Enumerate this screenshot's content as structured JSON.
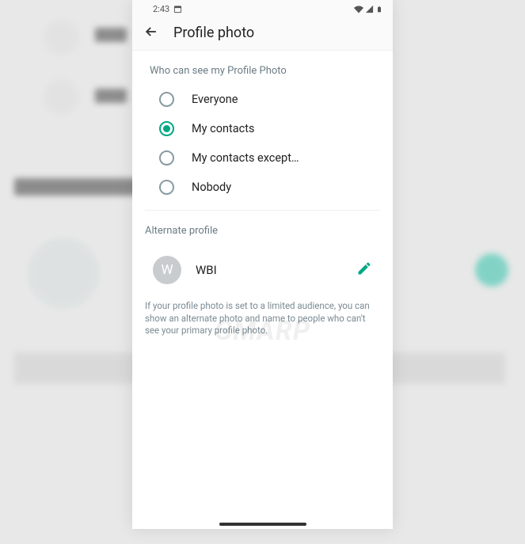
{
  "statusbar": {
    "time": "2:43"
  },
  "appbar": {
    "title": "Profile photo"
  },
  "privacy": {
    "section_label": "Who can see my Profile Photo",
    "selected_index": 1,
    "options": [
      {
        "label": "Everyone"
      },
      {
        "label": "My contacts"
      },
      {
        "label": "My contacts except…"
      },
      {
        "label": "Nobody"
      }
    ]
  },
  "alternate": {
    "section_label": "Alternate profile",
    "avatar_initial": "W",
    "name": "WBI",
    "help": "If your profile photo is set to a limited audience, you can show an alternate photo and name to people who can't see your primary profile photo."
  },
  "colors": {
    "accent": "#00a884"
  }
}
